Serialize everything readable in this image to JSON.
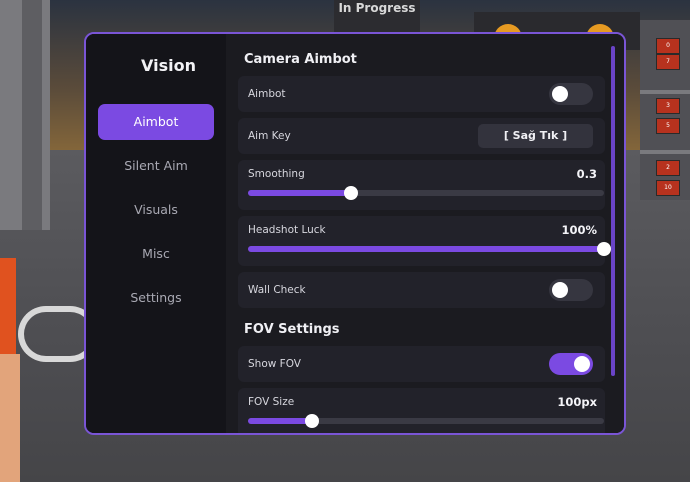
{
  "background": {
    "sign_text": "In Progress",
    "tags": [
      "0",
      "7",
      "3",
      "5",
      "2",
      "10"
    ]
  },
  "panel": {
    "title": "Vision",
    "nav": [
      {
        "label": "Aimbot",
        "active": true
      },
      {
        "label": "Silent Aim",
        "active": false
      },
      {
        "label": "Visuals",
        "active": false
      },
      {
        "label": "Misc",
        "active": false
      },
      {
        "label": "Settings",
        "active": false
      }
    ]
  },
  "camera_aimbot": {
    "title": "Camera Aimbot",
    "aimbot_label": "Aimbot",
    "aimbot_on": false,
    "aim_key_label": "Aim Key",
    "aim_key_value": "[ Sağ Tık ]",
    "smoothing_label": "Smoothing",
    "smoothing_value": "0.3",
    "smoothing_level": 0.29,
    "headshot_label": "Headshot Luck",
    "headshot_value": "100%",
    "headshot_level": 1.0,
    "wall_check_label": "Wall Check",
    "wall_check_on": false
  },
  "fov_settings": {
    "title": "FOV Settings",
    "show_fov_label": "Show FOV",
    "show_fov_on": true,
    "fov_size_label": "FOV Size",
    "fov_size_value": "100px",
    "fov_size_level": 0.18
  },
  "colors": {
    "accent": "#7b4ae2",
    "border": "#7a55d6",
    "panel_bg": "#141419",
    "row_bg": "#22222a"
  }
}
